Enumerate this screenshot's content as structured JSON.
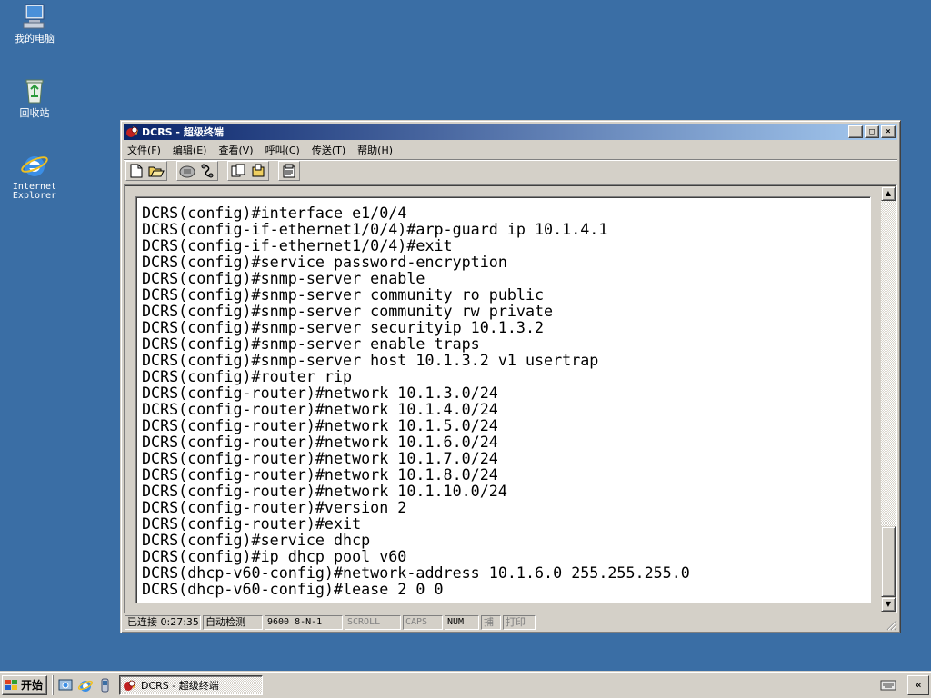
{
  "desktop": {
    "icons": [
      {
        "label": "我的电脑",
        "icon": "my-computer-icon"
      },
      {
        "label": "回收站",
        "icon": "recycle-bin-icon"
      },
      {
        "label": "Internet\nExplorer",
        "icon": "internet-explorer-icon"
      }
    ]
  },
  "window": {
    "title": "DCRS - 超级终端",
    "controls": {
      "minimize": "_",
      "maximize": "□",
      "close": "×"
    },
    "menu": [
      "文件(F)",
      "编辑(E)",
      "查看(V)",
      "呼叫(C)",
      "传送(T)",
      "帮助(H)"
    ],
    "toolbar": [
      "new-icon",
      "open-icon",
      "call-icon",
      "disconnect-icon",
      "send-icon",
      "receive-icon",
      "properties-icon"
    ],
    "terminal": {
      "lines": [
        "DCRS(config)#interface e1/0/4",
        "DCRS(config-if-ethernet1/0/4)#arp-guard ip 10.1.4.1",
        "DCRS(config-if-ethernet1/0/4)#exit",
        "DCRS(config)#service password-encryption",
        "DCRS(config)#snmp-server enable",
        "DCRS(config)#snmp-server community ro public",
        "DCRS(config)#snmp-server community rw private",
        "DCRS(config)#snmp-server securityip 10.1.3.2",
        "DCRS(config)#snmp-server enable traps",
        "DCRS(config)#snmp-server host 10.1.3.2 v1 usertrap",
        "DCRS(config)#router rip",
        "DCRS(config-router)#network 10.1.3.0/24",
        "DCRS(config-router)#network 10.1.4.0/24",
        "DCRS(config-router)#network 10.1.5.0/24",
        "DCRS(config-router)#network 10.1.6.0/24",
        "DCRS(config-router)#network 10.1.7.0/24",
        "DCRS(config-router)#network 10.1.8.0/24",
        "DCRS(config-router)#network 10.1.10.0/24",
        "DCRS(config-router)#version 2",
        "DCRS(config-router)#exit",
        "DCRS(config)#service dhcp",
        "DCRS(config)#ip dhcp pool v60",
        "DCRS(dhcp-v60-config)#network-address 10.1.6.0 255.255.255.0",
        "DCRS(dhcp-v60-config)#lease 2 0 0"
      ]
    },
    "status": {
      "connected": "已连接 0:27:35",
      "detect": "自动检测",
      "port": "9600 8-N-1",
      "scroll": "SCROLL",
      "caps": "CAPS",
      "num": "NUM",
      "capture": "捕",
      "print": "打印"
    }
  },
  "taskbar": {
    "start_label": "开始",
    "quick_launch": [
      "show-desktop-icon",
      "ie-quicklaunch-icon",
      "outlook-icon"
    ],
    "task_label": "DCRS - 超级终端"
  }
}
